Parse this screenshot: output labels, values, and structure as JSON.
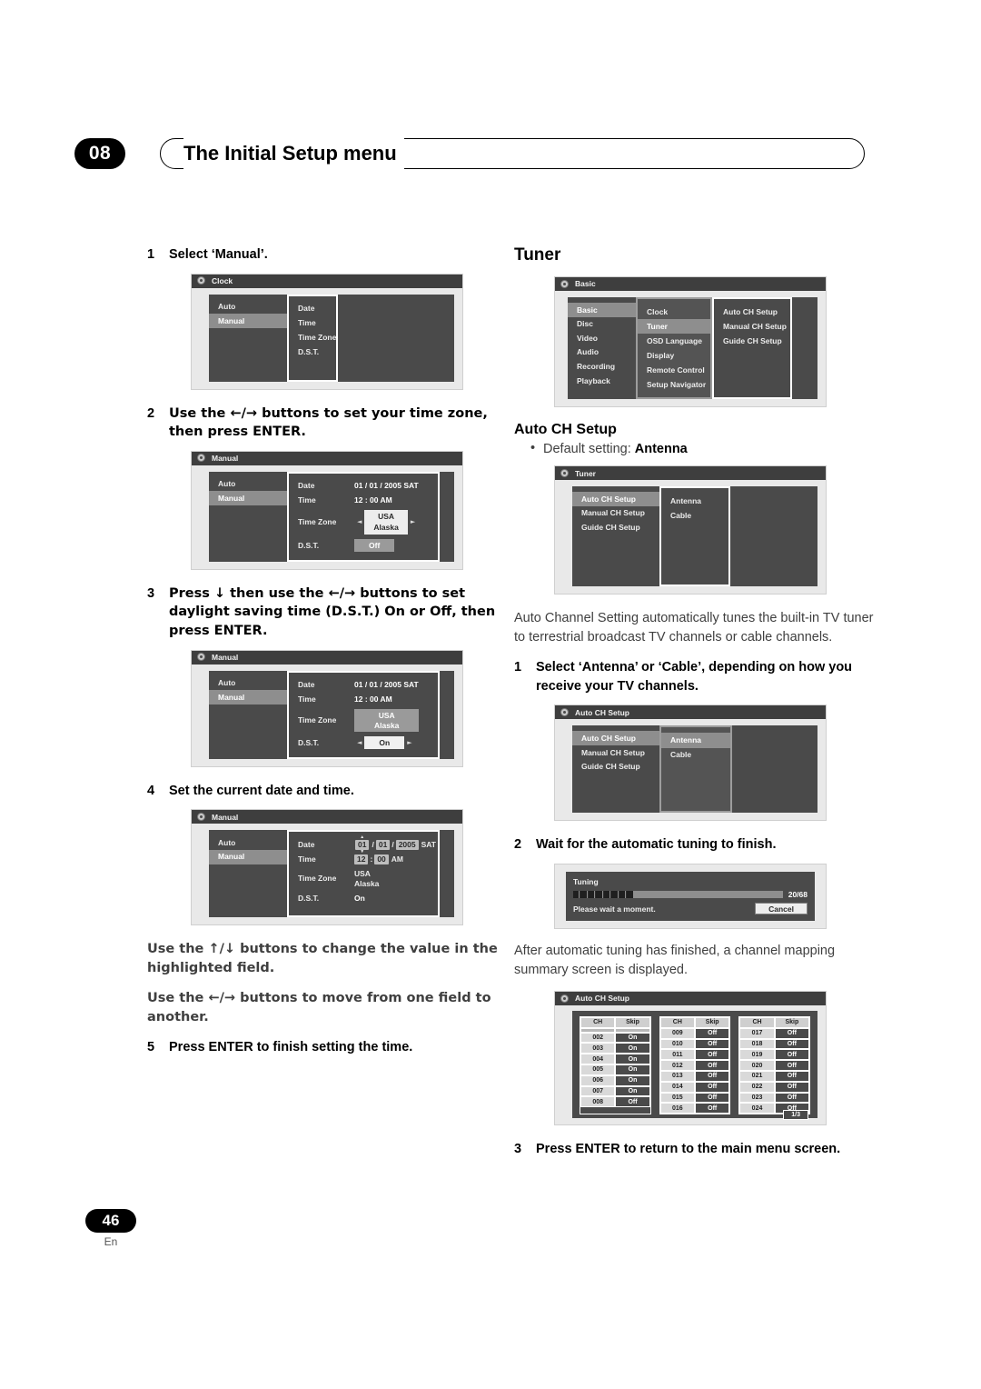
{
  "header": {
    "chapter": "08",
    "title": "The Initial Setup menu"
  },
  "footer": {
    "page": "46",
    "language": "En"
  },
  "left_column": {
    "step1": {
      "num": "1",
      "text": "Select ‘Manual’."
    },
    "clock_screen": {
      "title": "Clock",
      "left_menu": [
        {
          "label": "Auto",
          "selected": false
        },
        {
          "label": "Manual",
          "selected": true
        }
      ],
      "panel_rows": [
        "Date",
        "Time",
        "Time Zone",
        "D.S.T."
      ]
    },
    "step2": {
      "num": "2",
      "text": "Use the ←/→ buttons to set your time zone, then press ENTER."
    },
    "manual_screen_1": {
      "title": "Manual",
      "left_menu": [
        {
          "label": "Auto",
          "selected": false
        },
        {
          "label": "Manual",
          "selected": true
        }
      ],
      "rows": [
        {
          "label": "Date",
          "value": "01 / 01 / 2005 SAT"
        },
        {
          "label": "Time",
          "value": "12 : 00  AM"
        },
        {
          "label": "Time Zone",
          "value_line1": "USA",
          "value_line2": "Alaska"
        },
        {
          "label": "D.S.T.",
          "value": "Off"
        }
      ]
    },
    "step3": {
      "num": "3",
      "text": "Press ↓ then use the ←/→ buttons to set daylight saving time (D.S.T.) On or Off, then press ENTER."
    },
    "manual_screen_2": {
      "title": "Manual",
      "left_menu": [
        {
          "label": "Auto",
          "selected": false
        },
        {
          "label": "Manual",
          "selected": true
        }
      ],
      "rows": [
        {
          "label": "Date",
          "value": "01 / 01 / 2005 SAT"
        },
        {
          "label": "Time",
          "value": "12 : 00  AM"
        },
        {
          "label": "Time Zone",
          "value_line1": "USA",
          "value_line2": "Alaska"
        },
        {
          "label": "D.S.T.",
          "value": "On"
        }
      ]
    },
    "step4": {
      "num": "4",
      "text": "Set the current date and time."
    },
    "manual_screen_3": {
      "title": "Manual",
      "left_menu": [
        {
          "label": "Auto",
          "selected": false
        },
        {
          "label": "Manual",
          "selected": true
        }
      ],
      "rows": [
        {
          "label": "Date",
          "month": "01",
          "sep1": "/",
          "day": "01",
          "sep2": "/",
          "year": "2005",
          "weekday": "SAT"
        },
        {
          "label": "Time",
          "hour": "12",
          "colon": ":",
          "minute": "00",
          "meridiem": "AM"
        },
        {
          "label": "Time Zone",
          "value_line1": "USA",
          "value_line2": "Alaska"
        },
        {
          "label": "D.S.T.",
          "value": "On"
        }
      ]
    },
    "note1": "Use the ↑/↓ buttons to change the value in the highlighted field.",
    "note2": "Use the ←/→ buttons to move from one field to another.",
    "step5": {
      "num": "5",
      "text": "Press ENTER to finish setting the time."
    }
  },
  "right_column": {
    "section_title": "Tuner",
    "basic_screen": {
      "title": "Basic",
      "col1": [
        {
          "label": "Basic",
          "selected": true
        },
        {
          "label": "Disc",
          "selected": false
        },
        {
          "label": "Video",
          "selected": false
        },
        {
          "label": "Audio",
          "selected": false
        },
        {
          "label": "Recording",
          "selected": false
        },
        {
          "label": "Playback",
          "selected": false
        }
      ],
      "col2": [
        {
          "label": "Clock",
          "selected": false
        },
        {
          "label": "Tuner",
          "selected": true
        },
        {
          "label": "OSD Language",
          "selected": false
        },
        {
          "label": "Display",
          "selected": false
        },
        {
          "label": "Remote Control",
          "selected": false
        },
        {
          "label": "Setup Navigator",
          "selected": false
        }
      ],
      "col3": [
        {
          "label": "Auto CH Setup",
          "selected": false
        },
        {
          "label": "Manual CH Setup",
          "selected": false
        },
        {
          "label": "Guide CH Setup",
          "selected": false
        }
      ]
    },
    "auto_ch_heading": "Auto CH Setup",
    "default_setting_prefix": "Default setting: ",
    "default_setting_value": "Antenna",
    "tuner_screen": {
      "title": "Tuner",
      "col1": [
        {
          "label": "Auto CH Setup",
          "selected": true
        },
        {
          "label": "Manual CH Setup",
          "selected": false
        },
        {
          "label": "Guide CH Setup",
          "selected": false
        }
      ],
      "col2": [
        {
          "label": "Antenna",
          "selected": false
        },
        {
          "label": "Cable",
          "selected": false
        }
      ]
    },
    "intro_paragraph": "Auto Channel Setting automatically tunes the built-in TV tuner to terrestrial broadcast TV channels or cable channels.",
    "step1": {
      "num": "1",
      "text": "Select ‘Antenna’ or ‘Cable’, depending on how you receive your TV channels."
    },
    "auto_ch_screen": {
      "title": "Auto CH Setup",
      "col1": [
        {
          "label": "Auto CH Setup",
          "selected": true
        },
        {
          "label": "Manual CH Setup",
          "selected": false
        },
        {
          "label": "Guide CH Setup",
          "selected": false
        }
      ],
      "col2": [
        {
          "label": "Antenna",
          "selected": true
        },
        {
          "label": "Cable",
          "selected": false
        }
      ]
    },
    "step2": {
      "num": "2",
      "text": "Wait for the automatic tuning to finish."
    },
    "tuning_dialog": {
      "title": "Tuning",
      "progress_current": 20,
      "progress_total": 68,
      "progress_text": "20/68",
      "wait_text": "Please wait a moment.",
      "cancel_label": "Cancel"
    },
    "after_tuning_paragraph": "After automatic tuning has finished, a channel mapping summary screen is displayed.",
    "ch_summary_screen": {
      "title": "Auto CH Setup",
      "headers": [
        "CH",
        "Skip"
      ],
      "page_indicator": "1/3",
      "blocks": [
        [
          {
            "ch": "",
            "skip": "",
            "blank": true
          },
          {
            "ch": "002",
            "skip": "On"
          },
          {
            "ch": "003",
            "skip": "On"
          },
          {
            "ch": "004",
            "skip": "On"
          },
          {
            "ch": "005",
            "skip": "On"
          },
          {
            "ch": "006",
            "skip": "On"
          },
          {
            "ch": "007",
            "skip": "On"
          },
          {
            "ch": "008",
            "skip": "Off"
          }
        ],
        [
          {
            "ch": "009",
            "skip": "Off"
          },
          {
            "ch": "010",
            "skip": "Off"
          },
          {
            "ch": "011",
            "skip": "Off"
          },
          {
            "ch": "012",
            "skip": "Off"
          },
          {
            "ch": "013",
            "skip": "Off"
          },
          {
            "ch": "014",
            "skip": "Off"
          },
          {
            "ch": "015",
            "skip": "Off"
          },
          {
            "ch": "016",
            "skip": "Off"
          }
        ],
        [
          {
            "ch": "017",
            "skip": "Off"
          },
          {
            "ch": "018",
            "skip": "Off"
          },
          {
            "ch": "019",
            "skip": "Off"
          },
          {
            "ch": "020",
            "skip": "Off"
          },
          {
            "ch": "021",
            "skip": "Off"
          },
          {
            "ch": "022",
            "skip": "Off"
          },
          {
            "ch": "023",
            "skip": "Off"
          },
          {
            "ch": "024",
            "skip": "Off"
          }
        ]
      ]
    },
    "step3": {
      "num": "3",
      "text": "Press ENTER to return to the main menu screen."
    }
  }
}
